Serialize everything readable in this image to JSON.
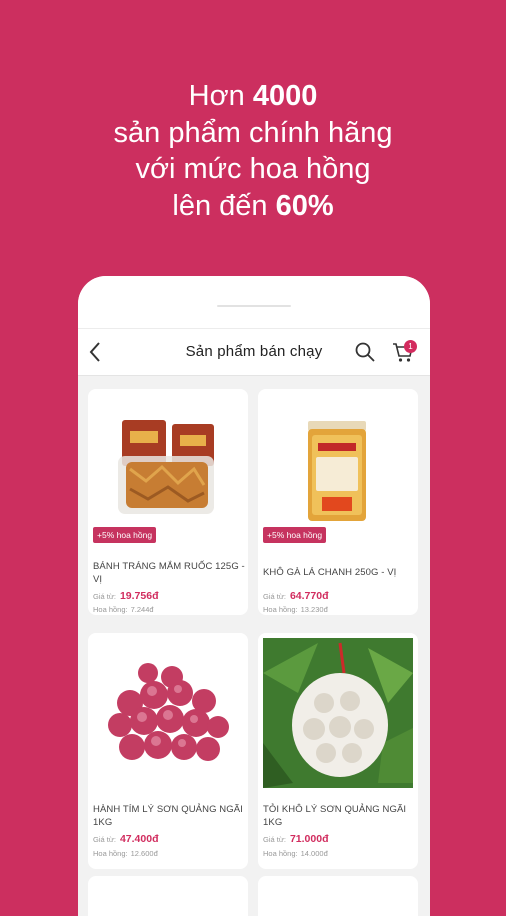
{
  "headline": {
    "line1_pre": "Hơn ",
    "line1_bold": "4000",
    "line2": "sản phẩm chính hãng",
    "line3": "với mức hoa hồng",
    "line4_pre": "lên đến ",
    "line4_bold": "60%"
  },
  "appbar": {
    "title": "Sản phẩm bán chạy",
    "cart_count": "1",
    "icons": [
      "chevron-left-icon",
      "search-icon",
      "cart-icon"
    ]
  },
  "products": [
    {
      "name": "BÁNH TRÁNG MẮM RUỐC 125G - VỊ",
      "promo": "+5% hoa hồng",
      "price_label": "Giá từ:",
      "price": "19.756đ",
      "commission_label": "Hoa hồng:",
      "commission": "7.244đ"
    },
    {
      "name": "KHÔ GÀ LÁ CHANH 250G - VỊ",
      "promo": "+5% hoa hồng",
      "price_label": "Giá từ:",
      "price": "64.770đ",
      "commission_label": "Hoa hồng:",
      "commission": "13.230đ"
    },
    {
      "name": "HÀNH TÍM LÝ SƠN QUẢNG NGÃI 1KG",
      "price_label": "Giá từ:",
      "price": "47.400đ",
      "commission_label": "Hoa hồng:",
      "commission": "12.600đ"
    },
    {
      "name": "TỎI KHÔ LÝ SƠN QUẢNG NGÃI 1KG",
      "price_label": "Giá từ:",
      "price": "71.000đ",
      "commission_label": "Hoa hồng:",
      "commission": "14.000đ"
    }
  ],
  "colors": {
    "background": "#cc2f5f",
    "accent": "#d12c5e",
    "promo_badge": "#c6335f"
  }
}
